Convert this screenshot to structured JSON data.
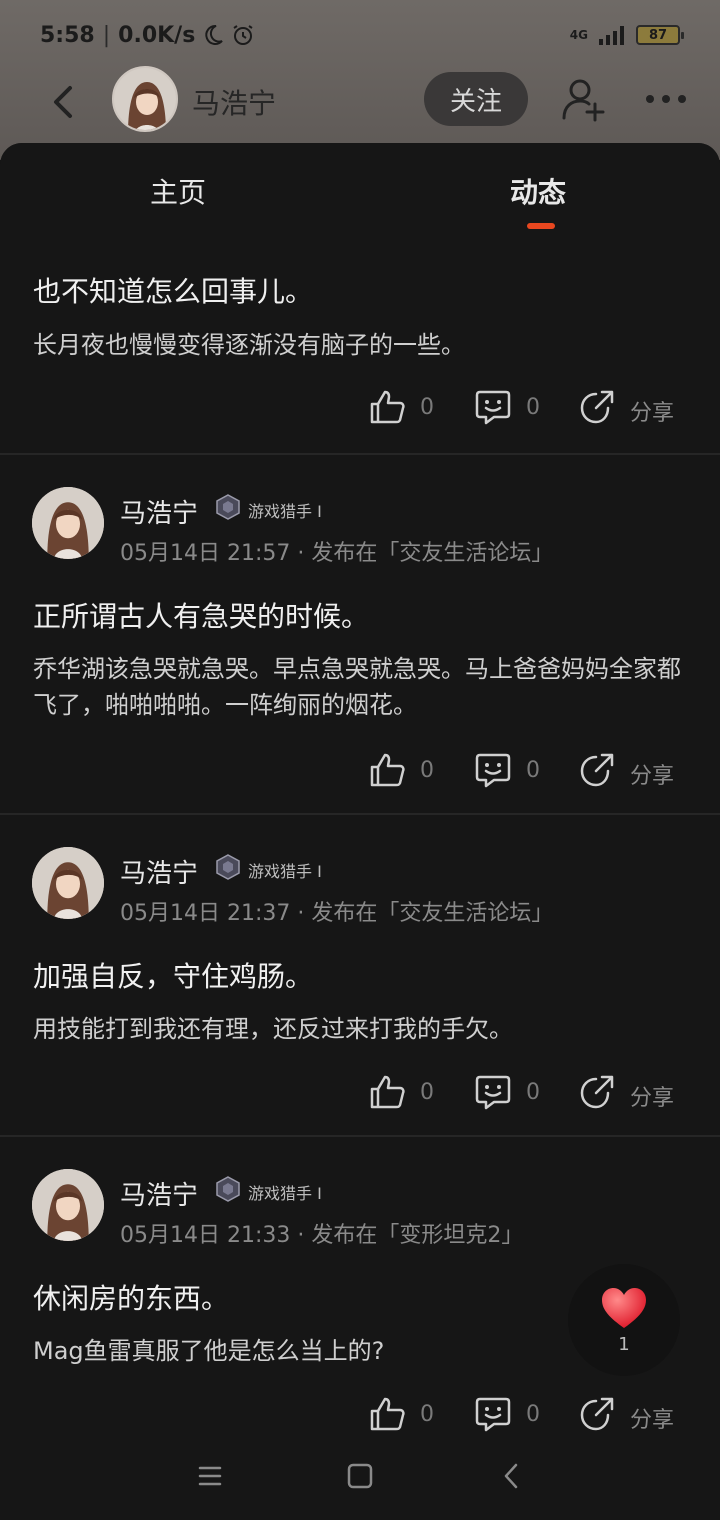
{
  "status": {
    "time": "5:58",
    "speed": "0.0K/s",
    "network": "4G",
    "battery": "87"
  },
  "header": {
    "name": "马浩宁",
    "follow_label": "关注"
  },
  "tabs": {
    "home": "主页",
    "feed": "动态"
  },
  "posts": [
    {
      "title": "也不知道怎么回事儿。",
      "body": "长月夜也慢慢变得逐渐没有脑子的一些。",
      "likes": "0",
      "comments": "0",
      "share": "分享"
    },
    {
      "author": "马浩宁",
      "badge": "游戏猎手 I",
      "meta": "05月14日 21:57 · 发布在「交友生活论坛」",
      "title": "正所谓古人有急哭的时候。",
      "body": "乔华湖该急哭就急哭。早点急哭就急哭。马上爸爸妈妈全家都飞了，啪啪啪啪。一阵绚丽的烟花。",
      "likes": "0",
      "comments": "0",
      "share": "分享"
    },
    {
      "author": "马浩宁",
      "badge": "游戏猎手 I",
      "meta": "05月14日 21:37 · 发布在「交友生活论坛」",
      "title": "加强自反，守住鸡肠。",
      "body": "用技能打到我还有理，还反过来打我的手欠。",
      "likes": "0",
      "comments": "0",
      "share": "分享"
    },
    {
      "author": "马浩宁",
      "badge": "游戏猎手 I",
      "meta": "05月14日 21:33 · 发布在「变形坦克2」",
      "title": "休闲房的东西。",
      "body": "Mag鱼雷真服了他是怎么当上的?",
      "likes": "0",
      "comments": "0",
      "share": "分享"
    }
  ],
  "floating_like": {
    "count": "1"
  }
}
